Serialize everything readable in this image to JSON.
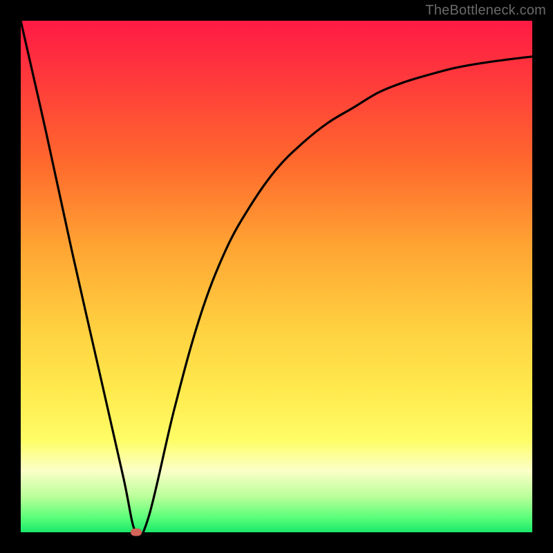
{
  "attribution": "TheBottleneck.com",
  "colors": {
    "page_bg": "#000000",
    "gradient_top": "#ff1a44",
    "gradient_bottom": "#19e86b",
    "curve": "#000000",
    "dot": "#d4635a",
    "attribution_text": "#6a6a6a"
  },
  "chart_data": {
    "type": "line",
    "title": "",
    "xlabel": "",
    "ylabel": "",
    "xlim": [
      0,
      100
    ],
    "ylim": [
      0,
      100
    ],
    "grid": false,
    "x": [
      0,
      5,
      10,
      15,
      20,
      22.5,
      25,
      30,
      35,
      40,
      45,
      50,
      55,
      60,
      65,
      70,
      75,
      80,
      85,
      90,
      95,
      100
    ],
    "y": [
      100,
      78,
      55,
      33,
      11,
      0,
      3,
      24,
      42,
      55,
      64,
      71,
      76,
      80,
      83,
      86,
      88,
      89.5,
      90.8,
      91.7,
      92.4,
      93
    ],
    "marker": {
      "x": 22.5,
      "y": 0
    }
  }
}
